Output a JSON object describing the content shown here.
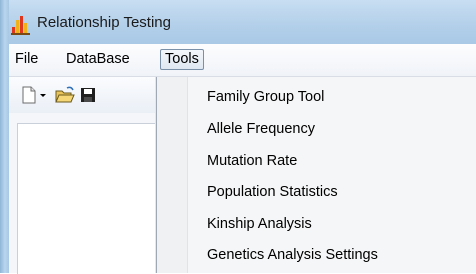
{
  "window": {
    "title": "Relationship Testing"
  },
  "menubar": {
    "items": [
      "File",
      "DataBase",
      "Tools"
    ],
    "active": "Tools"
  },
  "toolbar": {
    "icons": [
      "new-document-icon",
      "dropdown-arrow-icon",
      "open-folder-icon",
      "save-icon"
    ]
  },
  "tools_menu": {
    "items": [
      "Family Group Tool",
      "Allele Frequency",
      "Mutation Rate",
      "Population Statistics",
      "Kinship Analysis",
      "Genetics Analysis Settings"
    ]
  }
}
